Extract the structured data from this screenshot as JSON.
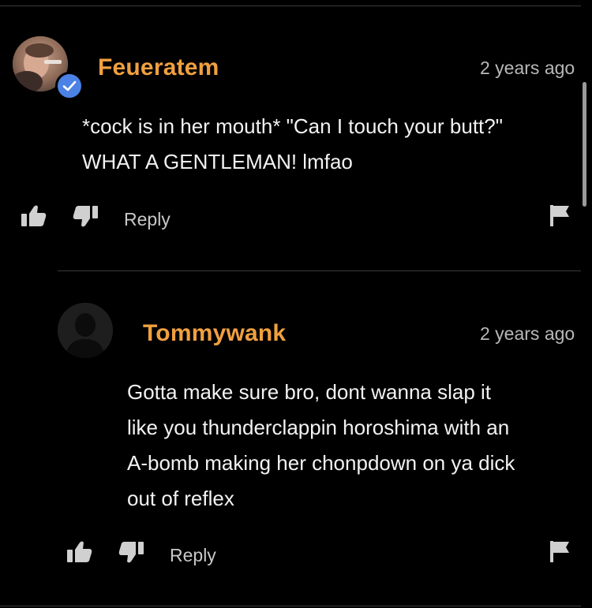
{
  "comments": [
    {
      "username": "Feueratem",
      "timestamp": "2 years ago",
      "body_lines": [
        "*cock is in her mouth* \"Can I touch your butt?\"",
        "WHAT A GENTLEMAN! lmfao"
      ],
      "verified": true,
      "avatar_icon": "user-photo-avatar",
      "actions": {
        "like_icon": "thumbs-up-icon",
        "dislike_icon": "thumbs-down-icon",
        "reply_label": "Reply",
        "flag_icon": "flag-icon"
      }
    },
    {
      "username": "Tommywank",
      "timestamp": "2 years ago",
      "body_lines": [
        "Gotta make sure bro, dont wanna slap it",
        "like you thunderclappin horoshima with an",
        "A-bomb making her chonpdown on ya dick",
        "out of reflex"
      ],
      "verified": false,
      "avatar_icon": "default-user-avatar",
      "actions": {
        "like_icon": "thumbs-up-icon",
        "dislike_icon": "thumbs-down-icon",
        "reply_label": "Reply",
        "flag_icon": "flag-icon"
      }
    }
  ],
  "colors": {
    "background": "#000000",
    "username": "#f0a040",
    "verified_badge": "#4c82e6",
    "text": "#f2f2f2",
    "muted": "#b8b8b8"
  }
}
